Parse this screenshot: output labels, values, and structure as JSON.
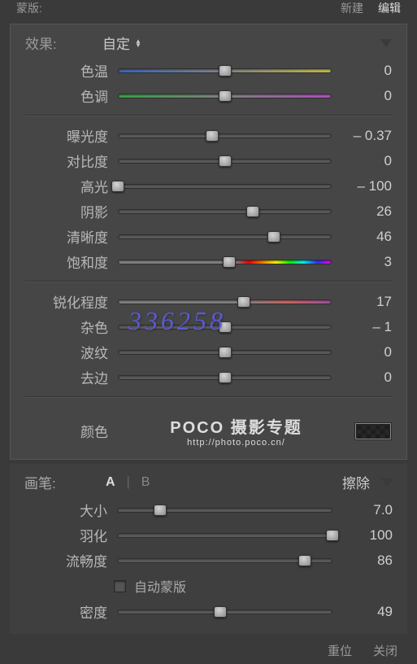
{
  "topbar": {
    "left": "蒙版:",
    "right1": "新建",
    "right2": "编辑"
  },
  "effects": {
    "title": "效果:",
    "preset": "自定",
    "groups": [
      [
        {
          "label": "色温",
          "value": "0",
          "pos": 50,
          "track": "temp"
        },
        {
          "label": "色调",
          "value": "0",
          "pos": 50,
          "track": "tint"
        }
      ],
      [
        {
          "label": "曝光度",
          "value": "– 0.37",
          "pos": 44,
          "track": "gray"
        },
        {
          "label": "对比度",
          "value": "0",
          "pos": 50,
          "track": "gray"
        },
        {
          "label": "高光",
          "value": "– 100",
          "pos": 0,
          "track": "gray"
        },
        {
          "label": "阴影",
          "value": "26",
          "pos": 63,
          "track": "gray"
        },
        {
          "label": "清晰度",
          "value": "46",
          "pos": 73,
          "track": "gray"
        },
        {
          "label": "饱和度",
          "value": "3",
          "pos": 52,
          "track": "sat"
        }
      ],
      [
        {
          "label": "锐化程度",
          "value": "17",
          "pos": 59,
          "track": "sharp"
        },
        {
          "label": "杂色",
          "value": "– 1",
          "pos": 50,
          "track": "gray"
        },
        {
          "label": "波纹",
          "value": "0",
          "pos": 50,
          "track": "gray"
        },
        {
          "label": "去边",
          "value": "0",
          "pos": 50,
          "track": "gray"
        }
      ]
    ],
    "color_label": "颜色",
    "watermark": {
      "main": "POCO 摄影专题",
      "sub": "http://photo.poco.cn/"
    }
  },
  "overlay": "336258",
  "brush": {
    "title": "画笔:",
    "a": "A",
    "b": "B",
    "erase": "擦除",
    "sliders": [
      {
        "label": "大小",
        "value": "7.0",
        "pos": 20,
        "track": "gray"
      },
      {
        "label": "羽化",
        "value": "100",
        "pos": 100,
        "track": "gray"
      },
      {
        "label": "流畅度",
        "value": "86",
        "pos": 87,
        "track": "gray"
      }
    ],
    "automask": "自动蒙版",
    "density": {
      "label": "密度",
      "value": "49",
      "pos": 48,
      "track": "gray"
    }
  },
  "footer": {
    "reset": "重位",
    "close": "关闭"
  }
}
